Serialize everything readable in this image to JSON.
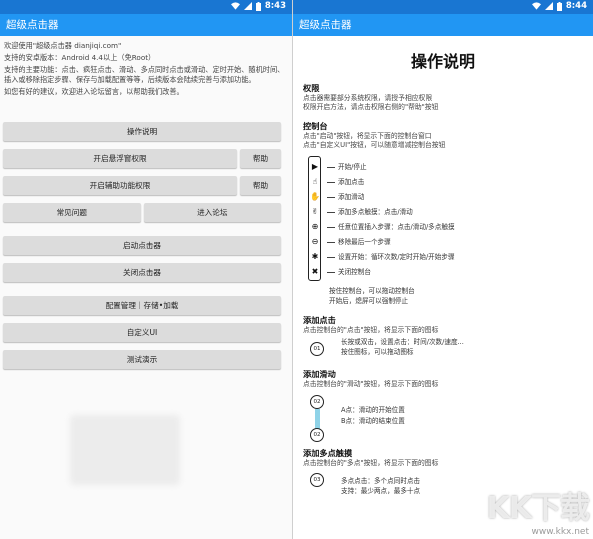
{
  "status": {
    "time": "8:43",
    "time_right": "8:44"
  },
  "app": {
    "title": "超级点击器"
  },
  "intro": {
    "lines": [
      "欢迎使用\"超级点击器 dianjiqi.com\"",
      "支持的安卓版本：Android 4.4以上（免Root）",
      "支持的主要功能：点击、疯狂点击、滑动、多点同时点击或滑动、定时开始、随机时间、插入或移除指定步骤、保存与加载配置等等，后续版本会陆续完善与添加功能。",
      "如您有好的建议，欢迎进入论坛留言，以帮助我们改善。"
    ]
  },
  "buttons": {
    "manual": "操作说明",
    "float_perm": "开启悬浮窗权限",
    "help1": "帮助",
    "access_perm": "开启辅助功能权限",
    "help2": "帮助",
    "faq": "常见问题",
    "forum": "进入论坛",
    "start": "启动点击器",
    "stop": "关闭点击器",
    "config": "配置管理｜存储•加载",
    "custom_ui": "自定义UI",
    "demo": "测试演示"
  },
  "doc": {
    "title": "操作说明",
    "perm_h": "权限",
    "perm_t1": "点击器需要部分系统权限，请授予相应权限",
    "perm_t2": "权限开启方法，请点击权限右侧的\"帮助\"按钮",
    "ctrl_h": "控制台",
    "ctrl_t1": "点击\"启动\"按钮，将显示下面的控制台窗口",
    "ctrl_t2": "点击\"自定义UI\"按钮，可以随意增减控制台按钮",
    "legend": [
      "开始/停止",
      "添加点击",
      "添加滑动",
      "添加多点触摸：点击/滑动",
      "任意位置插入步骤：点击/滑动/多点触摸",
      "移除最后一个步骤",
      "设置开始：循环次数/定时开始/开始步骤",
      "关闭控制台"
    ],
    "note1": "按住控制台，可以拖动控制台",
    "note2": "开始后，熄屏可以强制停止",
    "click_h": "添加点击",
    "click_t": "点击控制台的\"点击\"按钮，将显示下面的图标",
    "click_n1": "长按或双击，设置点击：时间/次数/速度...",
    "click_n2": "按住图标，可以拖动图标",
    "click_badge": "01",
    "swipe_h": "添加滑动",
    "swipe_t": "点击控制台的\"滑动\"按钮，将显示下面的图标",
    "swipe_n1": "A点：滑动的开始位置",
    "swipe_n2": "B点：滑动的结束位置",
    "swipe_badge_a": "02",
    "swipe_badge_b": "02",
    "multi_h": "添加多点触摸",
    "multi_t": "点击控制台的\"多点\"按钮，将显示下面的图标",
    "multi_n1": "多点点击：多个点同时点击",
    "multi_n2": "支持：最少两点，最多十点",
    "multi_badge": "03"
  },
  "watermark": {
    "logo": "KK下载",
    "url": "www.kkx.net"
  },
  "colors": {
    "statusbar": "#1976d2",
    "appbar": "#2196f3",
    "button": "#dcdcdc"
  }
}
